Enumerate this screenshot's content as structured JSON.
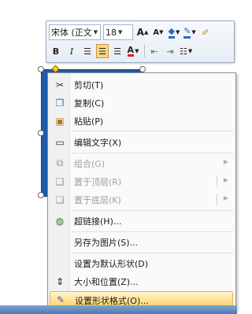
{
  "toolbar": {
    "font_name": "宋体 (正文",
    "font_size": "18",
    "grow_font": "A",
    "shrink_font": "A",
    "bold": "B",
    "italic": "I",
    "font_color_letter": "A"
  },
  "menu": {
    "items": [
      {
        "label": "剪切(T)",
        "icon": "scissors-icon",
        "enabled": true
      },
      {
        "label": "复制(C)",
        "icon": "copy-icon",
        "enabled": true
      },
      {
        "label": "粘贴(P)",
        "icon": "paste-icon",
        "enabled": true
      },
      {
        "label": "编辑文字(X)",
        "icon": "edit-text-icon",
        "enabled": true
      },
      {
        "label": "组合(G)",
        "icon": "group-icon",
        "enabled": false
      },
      {
        "label": "置于顶层(R)",
        "icon": "bring-to-front-icon",
        "enabled": false
      },
      {
        "label": "置于底层(K)",
        "icon": "send-to-back-icon",
        "enabled": false
      },
      {
        "label": "超链接(H)...",
        "icon": "hyperlink-icon",
        "enabled": true
      },
      {
        "label": "另存为图片(S)...",
        "icon": "",
        "enabled": true
      },
      {
        "label": "设置为默认形状(D)",
        "icon": "",
        "enabled": true
      },
      {
        "label": "大小和位置(Z)...",
        "icon": "size-position-icon",
        "enabled": true
      },
      {
        "label": "设置形状格式(O)...",
        "icon": "format-shape-icon",
        "enabled": true,
        "highlighted": true
      }
    ]
  },
  "colors": {
    "shape_fill": "#1f5ba8",
    "highlight": "#ffd36a"
  }
}
